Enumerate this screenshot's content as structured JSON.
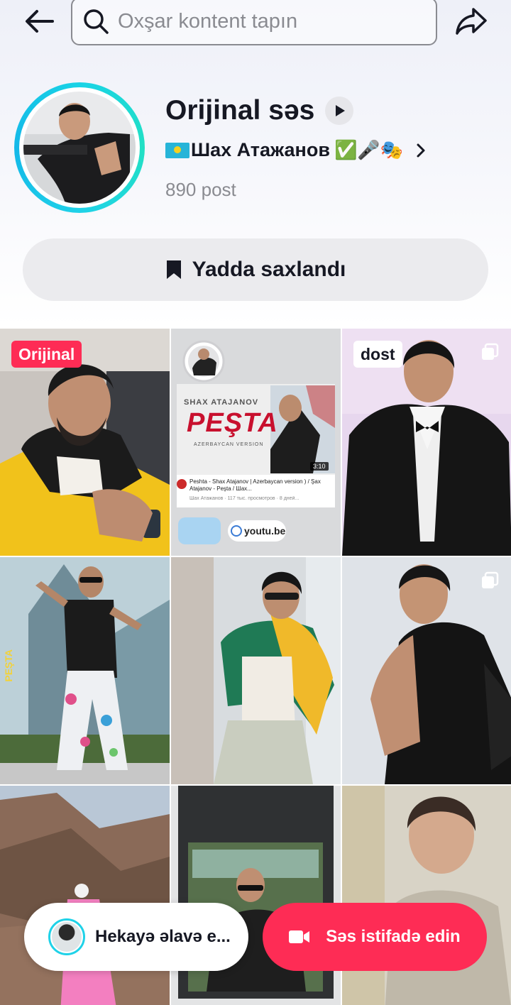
{
  "header": {
    "search_placeholder": "Oxşar kontent tapın",
    "back_icon": "arrow-left-icon",
    "share_icon": "share-arrow-icon"
  },
  "sound": {
    "title": "Orijinal səs",
    "artist": "Шах Атажанов",
    "artist_emojis": "✅🎤🎭",
    "post_count": "890 post"
  },
  "saved_button": {
    "label": "Yadda saxlandı",
    "icon": "bookmark-icon"
  },
  "grid": {
    "tiles": [
      {
        "badge": "Orijinal"
      },
      {
        "video_title": "PEŞTA",
        "video_subtitle": "SHAX ATAJANOV",
        "video_tag": "AZERBAYCAN VERSION",
        "video_duration": "3:10",
        "video_caption": "Peshta - Shax Atajanov | Azerbaycan version ) / Şax Atajanov - Peşta / Шах...",
        "video_meta": "Шах Атажанов · 117 тыс. просмотров · 8 дней...",
        "link_label": "youtu.be"
      },
      {
        "badge": "dost"
      },
      {
        "side_text": "PEŞTA"
      },
      {},
      {},
      {},
      {},
      {}
    ]
  },
  "bottom_bar": {
    "add_story_label": "Hekayə əlavə e...",
    "use_sound_label": "Səs istifadə edin"
  },
  "colors": {
    "accent": "#fe2c55",
    "ring": "#1fd2e8",
    "text_primary": "#161823",
    "text_secondary": "#8a8b91"
  }
}
